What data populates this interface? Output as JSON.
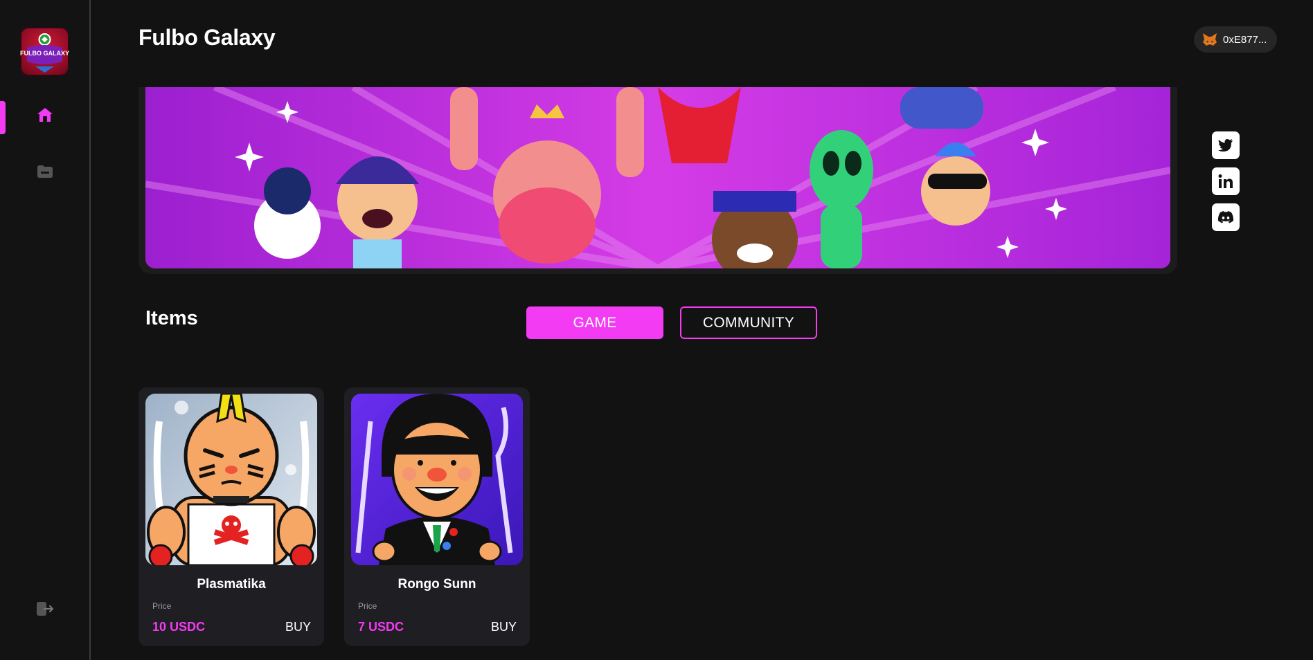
{
  "app": {
    "title": "Fulbo Galaxy",
    "logo_text": "FULBO GALAXY"
  },
  "sidebar": {
    "items": [
      {
        "icon": "home-icon",
        "active": true
      },
      {
        "icon": "folder-icon",
        "active": false
      }
    ],
    "logout_icon": "logout-icon"
  },
  "header": {
    "wallet_address": "0xE877...",
    "wallet_icon": "metamask-fox-icon"
  },
  "socials": [
    {
      "icon": "twitter-icon"
    },
    {
      "icon": "linkedin-icon"
    },
    {
      "icon": "discord-icon"
    }
  ],
  "items_section": {
    "title": "Items",
    "tabs": [
      {
        "label": "GAME",
        "active": true
      },
      {
        "label": "COMMUNITY",
        "active": false
      }
    ],
    "cards": [
      {
        "name": "Plasmatika",
        "price_label": "Price",
        "price": "10 USDC",
        "buy_label": "BUY"
      },
      {
        "name": "Rongo Sunn",
        "price_label": "Price",
        "price": "7 USDC",
        "buy_label": "BUY"
      }
    ]
  },
  "colors": {
    "accent": "#f23bf2",
    "background": "#121212",
    "card": "#1f1f23"
  }
}
